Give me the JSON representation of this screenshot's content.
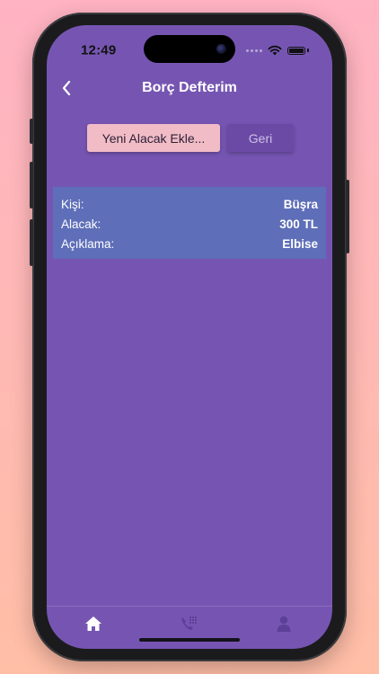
{
  "status_bar": {
    "time": "12:49"
  },
  "nav": {
    "title": "Borç Defterim",
    "back_icon": "chevron-left-icon"
  },
  "actions": {
    "add_label": "Yeni Alacak Ekle...",
    "back_label": "Geri"
  },
  "record": {
    "person_label": "Kişi:",
    "person_value": "Büşra",
    "amount_label": "Alacak:",
    "amount_value": "300 TL",
    "desc_label": "Açıklama:",
    "desc_value": "Elbise"
  },
  "tabs": [
    {
      "name": "home",
      "icon": "home-icon",
      "active": true
    },
    {
      "name": "contacts",
      "icon": "phone-dialpad-icon",
      "active": false
    },
    {
      "name": "profile",
      "icon": "person-icon",
      "active": false
    }
  ],
  "colors": {
    "background_top": "#ffb3c3",
    "background_bottom": "#ffbea6",
    "screen": "#7655b2",
    "card": "#5e6eb8",
    "primary_button": "#f2bcc6",
    "secondary_button": "#6b4aa6"
  }
}
